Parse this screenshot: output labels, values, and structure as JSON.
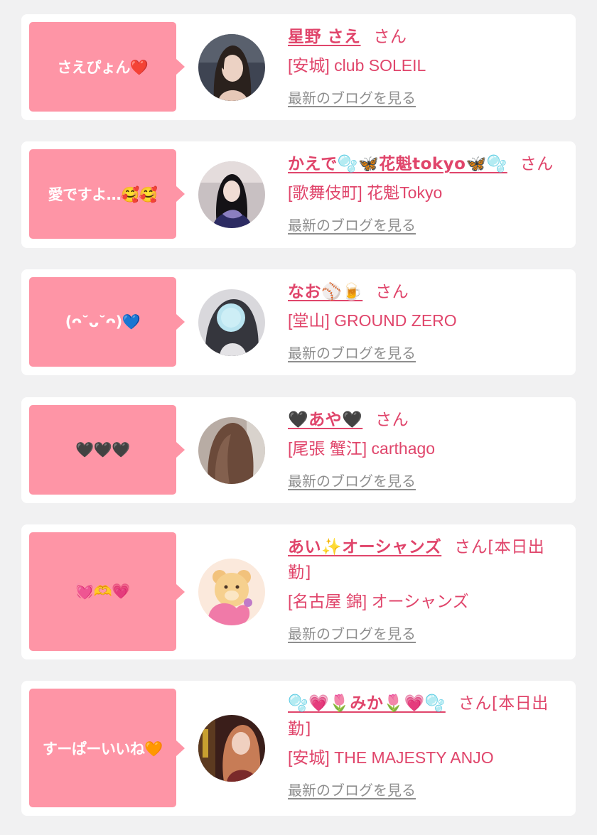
{
  "cards": [
    {
      "bubble": "さえぴょん❤️",
      "name": "星野 さえ",
      "san": "さん",
      "shop": "[安城] club SOLEIL",
      "blog": "最新のブログを見る"
    },
    {
      "bubble": "愛ですよ…🥰🥰",
      "name": "かえで🫧🦋花魁tokyo🦋🫧",
      "san": "さん",
      "shop": "[歌舞伎町] 花魁Tokyo",
      "blog": "最新のブログを見る"
    },
    {
      "bubble": "(ᴖ˘ᴗ˘ᴖ)💙",
      "name": "なお⚾️🍺",
      "san": "さん",
      "shop": "[堂山] GROUND ZERO",
      "blog": "最新のブログを見る"
    },
    {
      "bubble": "🖤🖤🖤",
      "name": "🖤あや🖤",
      "san": "さん",
      "shop": "[尾張 蟹江] carthago",
      "blog": "最新のブログを見る"
    },
    {
      "bubble": "💓🫶💗",
      "name": "あい✨オーシャンズ",
      "san": "さん[本日出勤]",
      "shop": "[名古屋 錦] オーシャンズ",
      "blog": "最新のブログを見る"
    },
    {
      "bubble": "すーぱーいいね🧡",
      "name": "🫧💗🌷みか🌷💗🫧",
      "san": "さん[本日出勤]",
      "shop": "[安城] THE MAJESTY ANJO",
      "blog": "最新のブログを見る"
    }
  ],
  "colors": {
    "background": "#f1f1f2",
    "card": "#ffffff",
    "bubble": "#fe95a6",
    "accent": "#e0456b",
    "muted": "#8e8e8e"
  },
  "avatars": [
    "avatar-woman-dark-hair",
    "avatar-woman-kimono",
    "avatar-blurred-face",
    "avatar-long-brown-hair",
    "avatar-teddy-bear-illustration",
    "avatar-woman-bar"
  ]
}
